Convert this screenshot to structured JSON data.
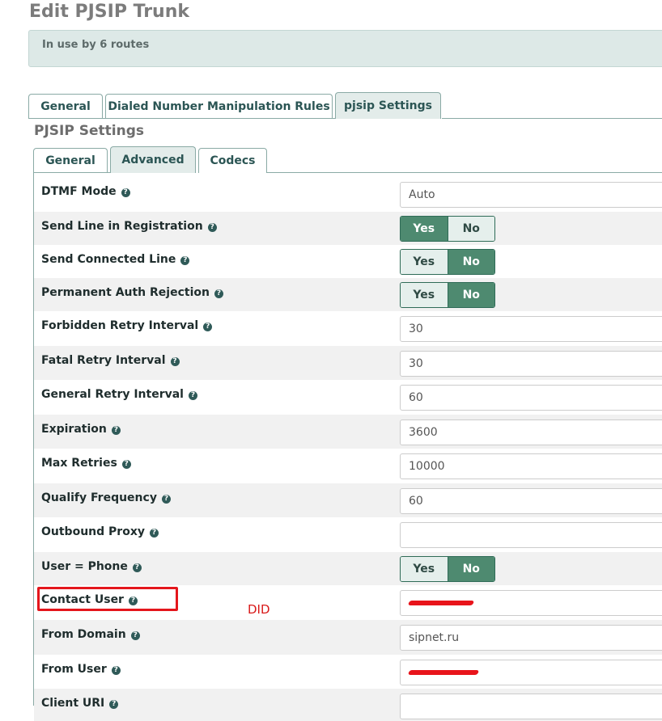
{
  "page": {
    "title": "Edit PJSIP Trunk",
    "in_use_notice": "In use by 6 routes",
    "section_title": "PJSIP Settings",
    "help_glyph": "?"
  },
  "main_tabs": [
    {
      "label": "General",
      "active": false
    },
    {
      "label": "Dialed Number Manipulation Rules",
      "active": false
    },
    {
      "label": "pjsip Settings",
      "active": true
    }
  ],
  "sub_tabs": [
    {
      "label": "General",
      "active": false
    },
    {
      "label": "Advanced",
      "active": true
    },
    {
      "label": "Codecs",
      "active": false
    }
  ],
  "toggle_labels": {
    "yes": "Yes",
    "no": "No"
  },
  "fields": [
    {
      "label": "DTMF Mode",
      "type": "select",
      "value": "Auto"
    },
    {
      "label": "Send Line in Registration",
      "type": "toggle",
      "value": "Yes"
    },
    {
      "label": "Send Connected Line",
      "type": "toggle",
      "value": "No"
    },
    {
      "label": "Permanent Auth Rejection",
      "type": "toggle",
      "value": "No"
    },
    {
      "label": "Forbidden Retry Interval",
      "type": "text",
      "value": "30"
    },
    {
      "label": "Fatal Retry Interval",
      "type": "text",
      "value": "30"
    },
    {
      "label": "General Retry Interval",
      "type": "text",
      "value": "60"
    },
    {
      "label": "Expiration",
      "type": "text",
      "value": "3600"
    },
    {
      "label": "Max Retries",
      "type": "text",
      "value": "10000"
    },
    {
      "label": "Qualify Frequency",
      "type": "text",
      "value": "60"
    },
    {
      "label": "Outbound Proxy",
      "type": "text",
      "value": ""
    },
    {
      "label": "User = Phone",
      "type": "toggle",
      "value": "No"
    },
    {
      "label": "Contact User",
      "type": "text",
      "value": "",
      "redacted": true
    },
    {
      "label": "From Domain",
      "type": "text",
      "value": "sipnet.ru"
    },
    {
      "label": "From User",
      "type": "text",
      "value": "",
      "redacted": true
    },
    {
      "label": "Client URI",
      "type": "text",
      "value": ""
    }
  ],
  "annotation": {
    "note": "DID",
    "color": "#e4161c"
  },
  "colors": {
    "toggle_active": "#4e8a70",
    "toggle_inactive": "#e5efec",
    "tab_border": "#8aaaa5",
    "notice_bg": "#dde9e7"
  }
}
